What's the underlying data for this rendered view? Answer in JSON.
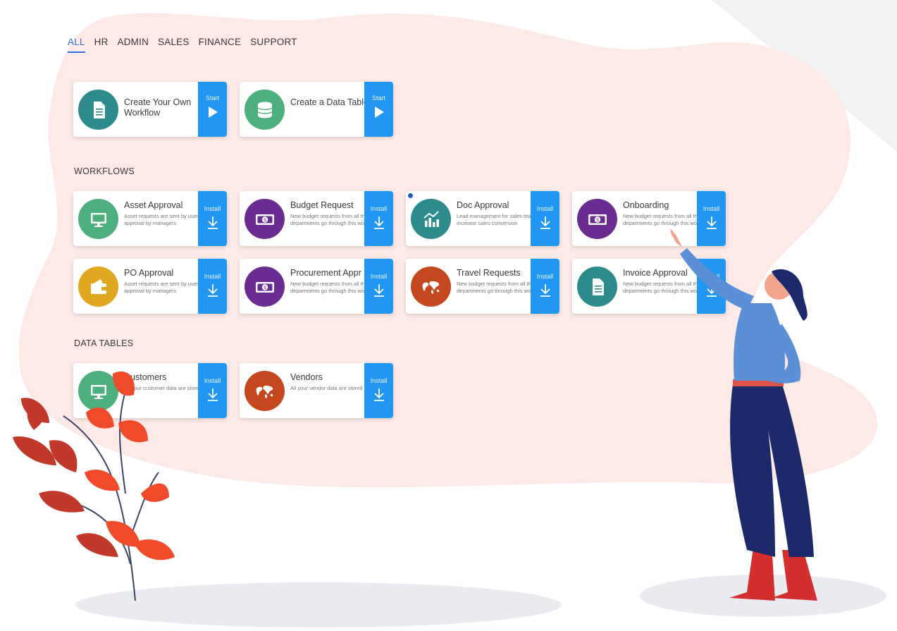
{
  "tabs": [
    {
      "label": "ALL",
      "active": true
    },
    {
      "label": "HR",
      "active": false
    },
    {
      "label": "ADMIN",
      "active": false
    },
    {
      "label": "SALES",
      "active": false
    },
    {
      "label": "FINANCE",
      "active": false
    },
    {
      "label": "SUPPORT",
      "active": false
    }
  ],
  "start_cards": [
    {
      "title": "Create Your Own Workflow",
      "action": "Start",
      "icon": "document-icon",
      "color": "#2e8b8b"
    },
    {
      "title": "Create a Data Table",
      "action": "Start",
      "icon": "database-icon",
      "color": "#4caf7d"
    }
  ],
  "sections": {
    "workflows": "WORKFLOWS",
    "data_tables": "DATA TABLES"
  },
  "workflows": [
    {
      "title": "Asset Approval",
      "desc": "Asset requests are sent by users for approval by managers",
      "action": "Install",
      "icon": "monitor-icon",
      "color": "#4caf7d"
    },
    {
      "title": "Budget Request",
      "desc": "New budget requests from all the departments go through this workflow",
      "action": "Install",
      "icon": "money-icon",
      "color": "#6a2c91"
    },
    {
      "title": "Doc Approval",
      "desc": "Lead management for sales teams to increase sales conversion",
      "action": "Install",
      "icon": "chart-icon",
      "color": "#2e8b8b"
    },
    {
      "title": "Onboarding",
      "desc": "New budget requests from all the departments go through this workflow",
      "action": "Install",
      "icon": "money-icon",
      "color": "#6a2c91"
    },
    {
      "title": "PO Approval",
      "desc": "Asset requests are sent by users for approval by managers",
      "action": "Install",
      "icon": "wallet-icon",
      "color": "#e0a81e"
    },
    {
      "title": "Procurement Appr",
      "desc": "New budget requests from all the departments go through this workflow",
      "action": "Install",
      "icon": "money-icon",
      "color": "#6a2c91"
    },
    {
      "title": "Travel Requests",
      "desc": "New budget requests from all the departments go through this workflow",
      "action": "Install",
      "icon": "world-map-icon",
      "color": "#c4471f"
    },
    {
      "title": "Invoice Approval",
      "desc": "New budget requests from all the departments go through this workflow",
      "action": "Install",
      "icon": "document-icon",
      "color": "#2e8b8b"
    }
  ],
  "data_tables": [
    {
      "title": "Customers",
      "desc": "All your customer data are stored here.",
      "action": "Install",
      "icon": "monitor-icon",
      "color": "#4caf7d"
    },
    {
      "title": "Vendors",
      "desc": "All your vendor data are stored here.",
      "action": "Install",
      "icon": "world-map-icon",
      "color": "#c4471f"
    }
  ],
  "colors": {
    "accent": "#2196f3",
    "tab_active": "#2f6fd6",
    "blob": "#fde9e6"
  }
}
